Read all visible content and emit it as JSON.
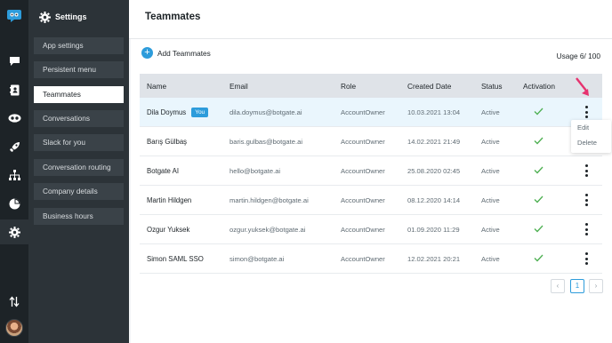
{
  "colors": {
    "accent": "#2d9cdb",
    "rail": "#1d2327",
    "menu": "#2c3338",
    "check": "#4caf50",
    "pointer_arrow": "#e6336f"
  },
  "rail": {
    "icons": [
      "logo-icon",
      "chat-icon",
      "contacts-icon",
      "bot-icon",
      "rocket-icon",
      "flow-icon",
      "analytics-icon",
      "settings-icon",
      "sort-icon",
      "avatar"
    ]
  },
  "settings_menu": {
    "title": "Settings",
    "items": [
      {
        "label": "App settings"
      },
      {
        "label": "Persistent menu"
      },
      {
        "label": "Teammates",
        "active": true
      },
      {
        "label": "Conversations"
      },
      {
        "label": "Slack for you"
      },
      {
        "label": "Conversation routing"
      },
      {
        "label": "Company details"
      },
      {
        "label": "Business hours"
      }
    ]
  },
  "page": {
    "title": "Teammates",
    "add_label": "Add Teammates",
    "usage": "Usage 6/ 100"
  },
  "table": {
    "headers": {
      "name": "Name",
      "email": "Email",
      "role": "Role",
      "created": "Created Date",
      "status": "Status",
      "activation": "Activation"
    },
    "rows": [
      {
        "name": "Dila Doymus",
        "badge": "You",
        "email": "dila.doymus@botgate.ai",
        "role": "AccountOwner",
        "created": "10.03.2021 13:04",
        "status": "Active",
        "activated": true
      },
      {
        "name": "Barış Gülbaş",
        "email": "baris.gulbas@botgate.ai",
        "role": "AccountOwner",
        "created": "14.02.2021 21:49",
        "status": "Active",
        "activated": true
      },
      {
        "name": "Botgate AI",
        "email": "hello@botgate.ai",
        "role": "AccountOwner",
        "created": "25.08.2020 02:45",
        "status": "Active",
        "activated": true
      },
      {
        "name": "Martin Hildgen",
        "email": "martin.hildgen@botgate.ai",
        "role": "AccountOwner",
        "created": "08.12.2020 14:14",
        "status": "Active",
        "activated": true
      },
      {
        "name": "Ozgur Yuksek",
        "email": "ozgur.yuksek@botgate.ai",
        "role": "AccountOwner",
        "created": "01.09.2020 11:29",
        "status": "Active",
        "activated": true
      },
      {
        "name": "Simon SAML SSO",
        "email": "simon@botgate.ai",
        "role": "AccountOwner",
        "created": "12.02.2021 20:21",
        "status": "Active",
        "activated": true
      }
    ]
  },
  "row_menu": {
    "edit": "Edit",
    "delete": "Delete"
  },
  "pagination": {
    "prev": "‹",
    "current": "1",
    "next": "›"
  }
}
